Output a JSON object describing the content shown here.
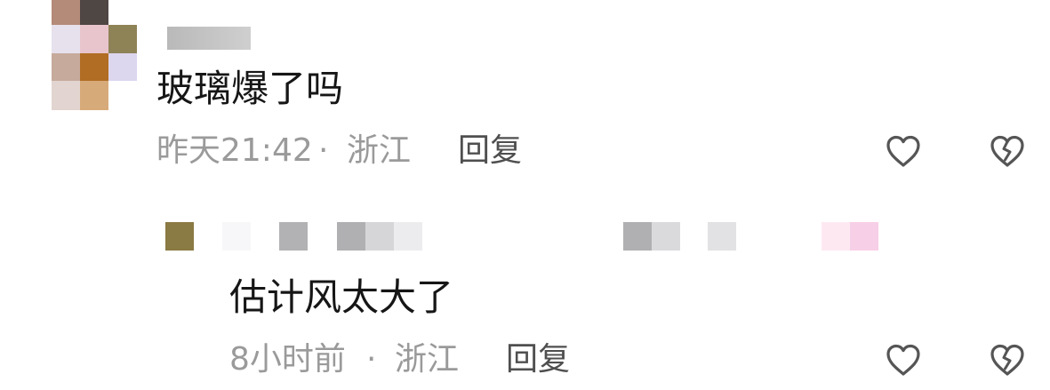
{
  "comments": [
    {
      "text": "玻璃爆了吗",
      "time": "昨天21:42",
      "separator": "·",
      "location": "浙江",
      "reply_label": "回复",
      "like_icon": "heart-outline-icon",
      "dislike_icon": "broken-heart-icon"
    },
    {
      "text": "估计风太大了",
      "time": "8小时前",
      "separator": "·",
      "location": "浙江",
      "reply_label": "回复",
      "like_icon": "heart-outline-icon",
      "dislike_icon": "broken-heart-icon"
    }
  ],
  "colors": {
    "text": "#161616",
    "meta": "#9a9a9a",
    "reply": "#4f4f4f",
    "icon_stroke": "#555555"
  }
}
